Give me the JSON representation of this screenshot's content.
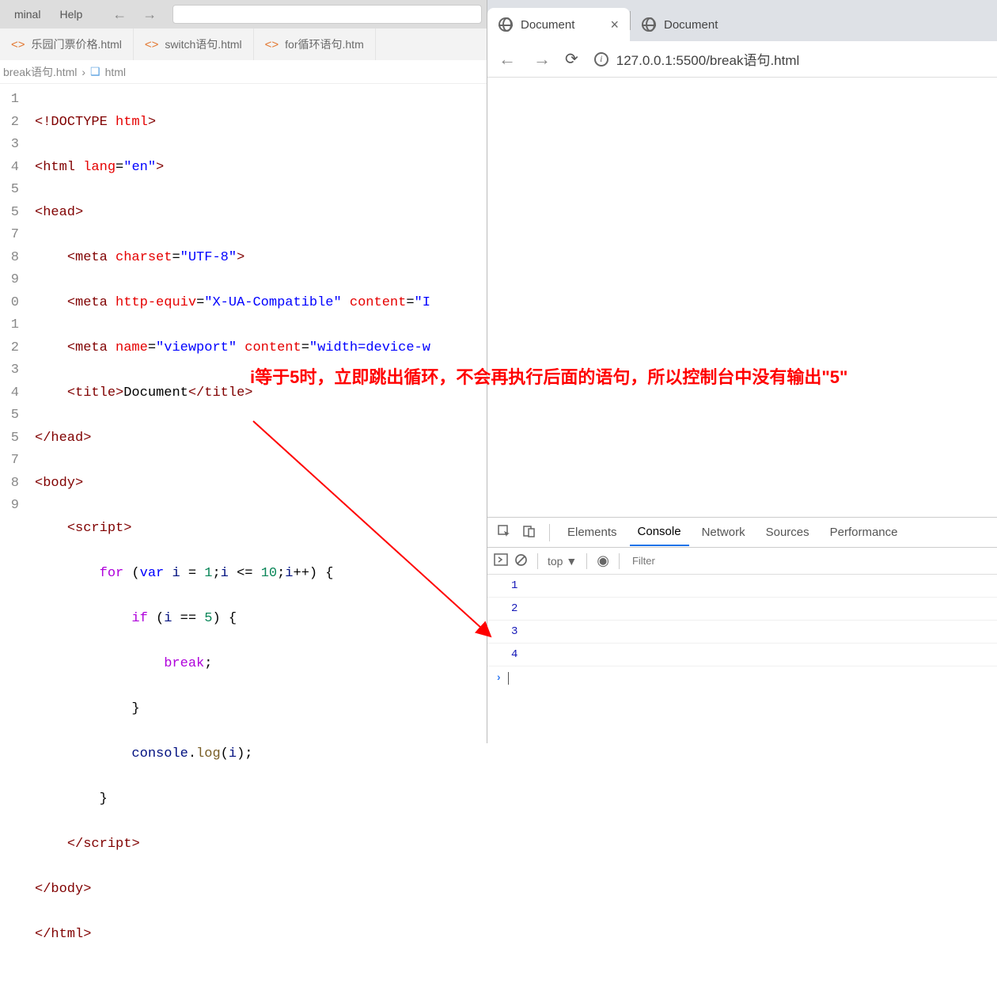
{
  "menubar": {
    "items": [
      "minal",
      "Help"
    ]
  },
  "fileTabs": [
    {
      "label": "乐园门票价格.html"
    },
    {
      "label": "switch语句.html"
    },
    {
      "label": "for循环语句.htm"
    }
  ],
  "breadcrumb": {
    "file": "break语句.html",
    "symbol": "html"
  },
  "editor": {
    "lineNumbers": [
      "1",
      "2",
      "3",
      "4",
      "5",
      "5",
      "7",
      "8",
      "9",
      "0",
      "1",
      "2",
      "3",
      "4",
      "5",
      "5",
      "7",
      "8",
      "9"
    ]
  },
  "code": {
    "docTitle": "Document",
    "charset": "UTF-8",
    "httpEquiv": "X-UA-Compatible",
    "viewportName": "viewport",
    "viewportContent": "width=device-w",
    "lang": "en",
    "loopInit": "1",
    "loopCond": "10",
    "ifCond": "5"
  },
  "annotation": "i等于5时，立即跳出循环，不会再执行后面的语句，所以控制台中没有输出\"5\"",
  "browser": {
    "tabs": [
      {
        "title": "Document",
        "active": true
      },
      {
        "title": "Document",
        "active": false
      }
    ],
    "url": "127.0.0.1:5500/break语句.html"
  },
  "devtools": {
    "tabs": [
      "Elements",
      "Console",
      "Network",
      "Sources",
      "Performance"
    ],
    "activeTab": "Console",
    "context": "top",
    "filterPlaceholder": "Filter",
    "consoleOutput": [
      "1",
      "2",
      "3",
      "4"
    ]
  }
}
